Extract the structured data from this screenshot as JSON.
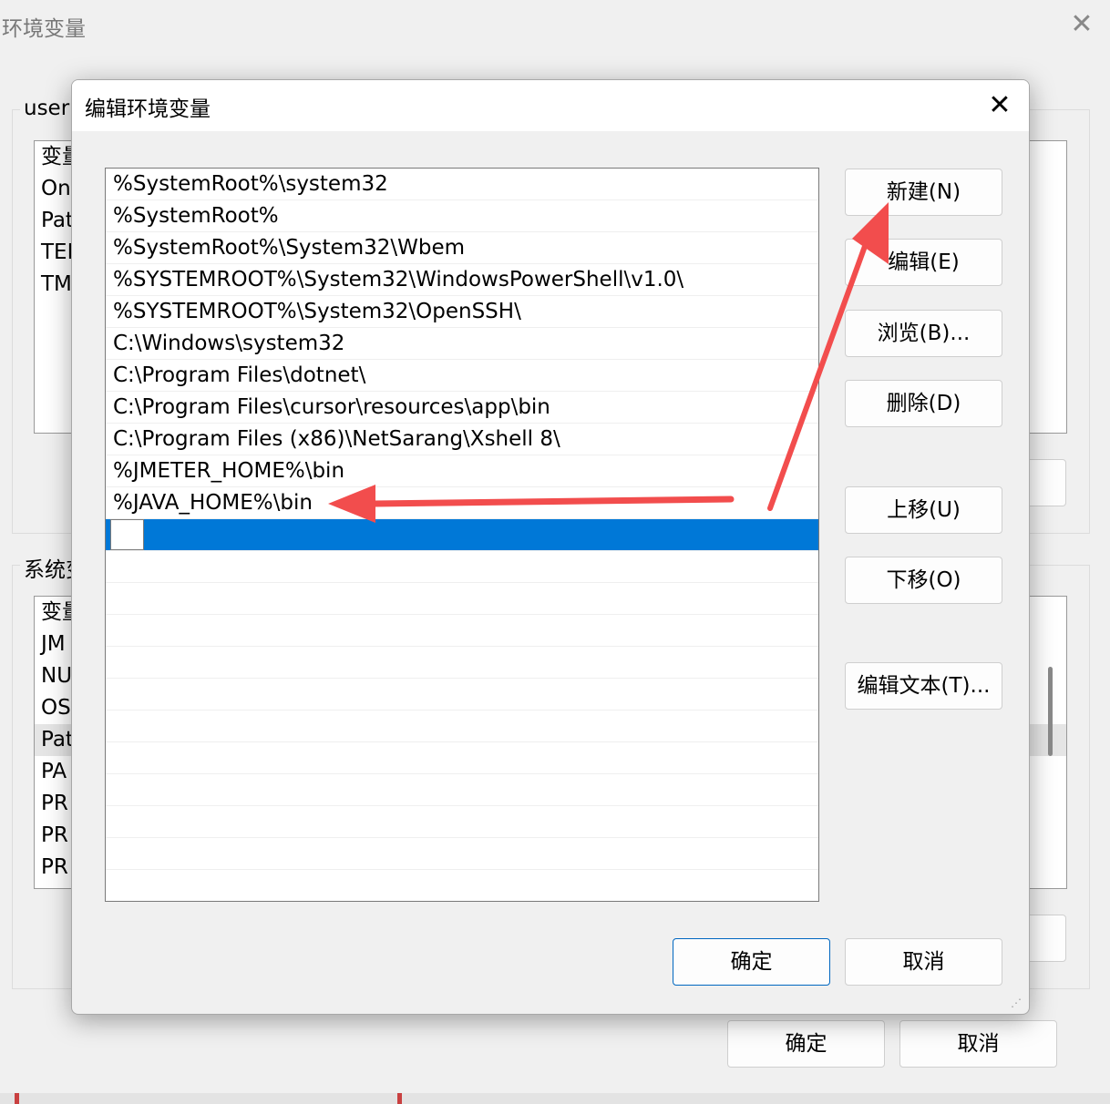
{
  "background_window": {
    "title": "环境变量",
    "user_group_label": "user",
    "user_vars": [
      "变量",
      "On",
      "Pat",
      "TEI",
      "TM"
    ],
    "system_group_label": "系统变",
    "system_vars": [
      "变量",
      "JM",
      "NU",
      "OS",
      "Pat",
      "PA",
      "PR",
      "PR",
      "PR"
    ],
    "ok_label": "确定",
    "cancel_label": "取消"
  },
  "dialog": {
    "title": "编辑环境变量",
    "paths": [
      "%SystemRoot%\\system32",
      "%SystemRoot%",
      "%SystemRoot%\\System32\\Wbem",
      "%SYSTEMROOT%\\System32\\WindowsPowerShell\\v1.0\\",
      "%SYSTEMROOT%\\System32\\OpenSSH\\",
      "C:\\Windows\\system32",
      "C:\\Program Files\\dotnet\\",
      "C:\\Program Files\\cursor\\resources\\app\\bin",
      "C:\\Program Files (x86)\\NetSarang\\Xshell 8\\",
      "%JMETER_HOME%\\bin",
      "%JAVA_HOME%\\bin"
    ],
    "editing_value": "",
    "buttons": {
      "new": "新建(N)",
      "edit": "编辑(E)",
      "browse": "浏览(B)...",
      "delete": "删除(D)",
      "move_up": "上移(U)",
      "move_down": "下移(O)",
      "edit_text": "编辑文本(T)...",
      "ok": "确定",
      "cancel": "取消"
    }
  },
  "annotation": {
    "color": "#f24d4d"
  }
}
